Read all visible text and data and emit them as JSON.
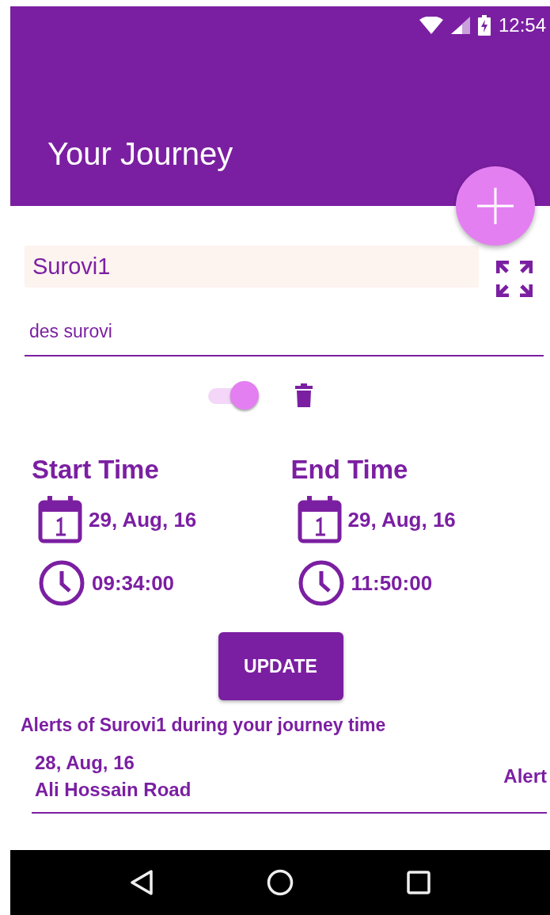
{
  "status_bar": {
    "time": "12:54"
  },
  "app_bar": {
    "title": "Your Journey"
  },
  "form": {
    "name": "Surovi1",
    "description": "des surovi",
    "enabled": true
  },
  "times": [
    {
      "heading": "Start Time",
      "date": "29, Aug, 16",
      "time": "09:34:00"
    },
    {
      "heading": "End Time",
      "date": "29, Aug, 16",
      "time": "11:50:00"
    }
  ],
  "update_button": "UPDATE",
  "alerts_heading": "Alerts of Surovi1 during your journey time",
  "alerts": [
    {
      "date": "28, Aug, 16",
      "place": "Ali Hossain Road",
      "action": "Alert"
    }
  ]
}
